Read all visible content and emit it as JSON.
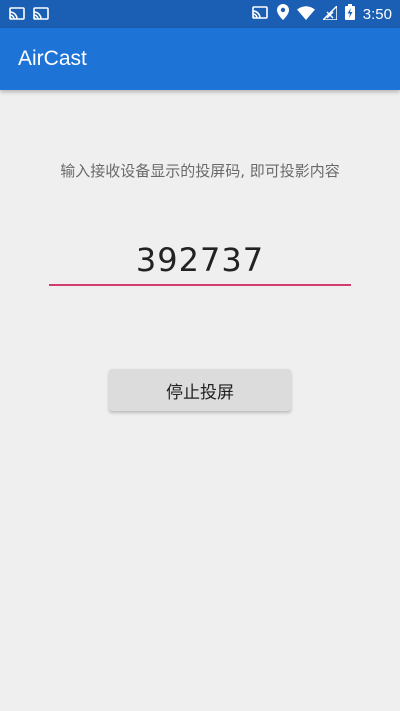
{
  "status_bar": {
    "time": "3:50",
    "left_icons": [
      "cast-icon",
      "cast-icon"
    ],
    "right_icons": [
      "cast-icon",
      "location-icon",
      "wifi-icon",
      "no-signal-icon",
      "battery-charging-icon"
    ]
  },
  "app_bar": {
    "title": "AirCast",
    "color": "#1e73d6"
  },
  "main": {
    "instruction": "输入接收设备显示的投屏码, 即可投影内容",
    "code": "392737",
    "stop_button_label": "停止投屏",
    "accent_color": "#d33c6e"
  }
}
